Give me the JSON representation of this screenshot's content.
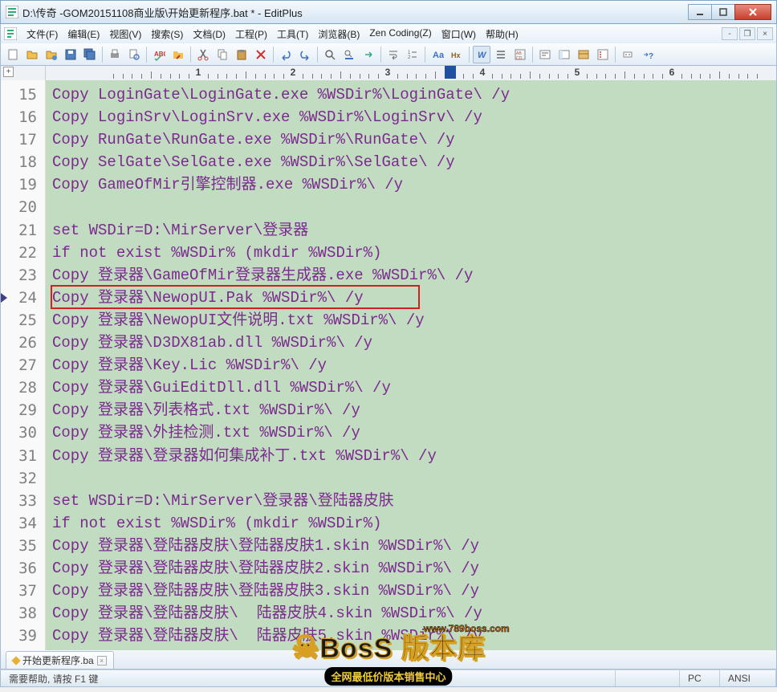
{
  "window": {
    "title": "D:\\传奇  -GOM20151108商业版\\开始更新程序.bat * - EditPlus"
  },
  "menus": [
    "文件(F)",
    "编辑(E)",
    "视图(V)",
    "搜索(S)",
    "文档(D)",
    "工程(P)",
    "工具(T)",
    "浏览器(B)",
    "Zen Coding(Z)",
    "窗口(W)",
    "帮助(H)"
  ],
  "ruler": {
    "numbers": [
      "1",
      "2",
      "3",
      "4",
      "5",
      "6"
    ]
  },
  "code": {
    "first_line": 15,
    "current_line": 24,
    "highlighted_line": 24,
    "lines": [
      "Copy LoginGate\\LoginGate.exe %WSDir%\\LoginGate\\ /y",
      "Copy LoginSrv\\LoginSrv.exe %WSDir%\\LoginSrv\\ /y",
      "Copy RunGate\\RunGate.exe %WSDir%\\RunGate\\ /y",
      "Copy SelGate\\SelGate.exe %WSDir%\\SelGate\\ /y",
      "Copy GameOfMir引擎控制器.exe %WSDir%\\ /y",
      "",
      "set WSDir=D:\\MirServer\\登录器",
      "if not exist %WSDir% (mkdir %WSDir%)",
      "Copy 登录器\\GameOfMir登录器生成器.exe %WSDir%\\ /y",
      "Copy 登录器\\NewopUI.Pak %WSDir%\\ /y",
      "Copy 登录器\\NewopUI文件说明.txt %WSDir%\\ /y",
      "Copy 登录器\\D3DX81ab.dll %WSDir%\\ /y",
      "Copy 登录器\\Key.Lic %WSDir%\\ /y",
      "Copy 登录器\\GuiEditDll.dll %WSDir%\\ /y",
      "Copy 登录器\\列表格式.txt %WSDir%\\ /y",
      "Copy 登录器\\外挂检测.txt %WSDir%\\ /y",
      "Copy 登录器\\登录器如何集成补丁.txt %WSDir%\\ /y",
      "",
      "set WSDir=D:\\MirServer\\登录器\\登陆器皮肤",
      "if not exist %WSDir% (mkdir %WSDir%)",
      "Copy 登录器\\登陆器皮肤\\登陆器皮肤1.skin %WSDir%\\ /y",
      "Copy 登录器\\登陆器皮肤\\登陆器皮肤2.skin %WSDir%\\ /y",
      "Copy 登录器\\登陆器皮肤\\登陆器皮肤3.skin %WSDir%\\ /y",
      "Copy 登录器\\登陆器皮肤\\  陆器皮肤4.skin %WSDir%\\ /y",
      "Copy 登录器\\登陆器皮肤\\  陆器皮肤5.skin %WSDir%\\ /y"
    ]
  },
  "filetab": {
    "name": "开始更新程序.ba",
    "modified": true
  },
  "status": {
    "hint": "需要帮助, 请按 F1 键",
    "mode": "PC",
    "encoding": "ANSI"
  },
  "watermark": {
    "url": "www.789boss.com",
    "brand": "BosS 版本库",
    "sub": "全网最低价版本销售中心"
  }
}
